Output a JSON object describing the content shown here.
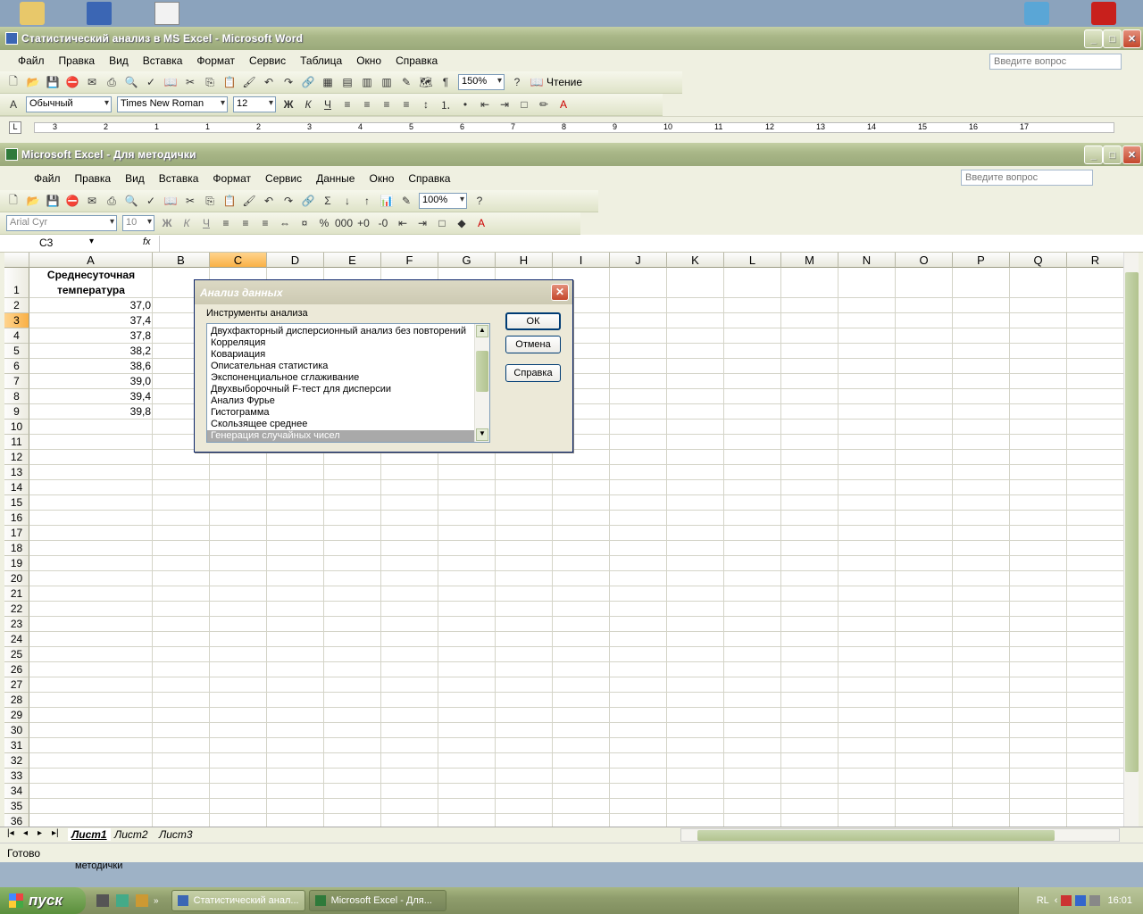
{
  "word": {
    "title": "Статистический анализ в MS Excel - Microsoft Word",
    "menu": [
      "Файл",
      "Правка",
      "Вид",
      "Вставка",
      "Формат",
      "Сервис",
      "Таблица",
      "Окно",
      "Справка"
    ],
    "question_placeholder": "Введите вопрос",
    "zoom": "150%",
    "reading_button": "Чтение",
    "style": "Обычный",
    "font": "Times New Roman",
    "font_size": "12",
    "ruler_numbers": [
      "3",
      "2",
      "1",
      "1",
      "2",
      "3",
      "4",
      "5",
      "6",
      "7",
      "8",
      "9",
      "10",
      "11",
      "12",
      "13",
      "14",
      "15",
      "16",
      "17"
    ]
  },
  "excel": {
    "title": "Microsoft Excel - Для методички",
    "menu": [
      "Файл",
      "Правка",
      "Вид",
      "Вставка",
      "Формат",
      "Сервис",
      "Данные",
      "Окно",
      "Справка"
    ],
    "question_placeholder": "Введите вопрос",
    "zoom": "100%",
    "font": "Arial Cyr",
    "font_size": "10",
    "name_box": "C3",
    "fx": "fx",
    "columns": [
      "A",
      "B",
      "C",
      "D",
      "E",
      "F",
      "G",
      "H",
      "I",
      "J",
      "K",
      "L",
      "M",
      "N",
      "O",
      "P",
      "Q",
      "R"
    ],
    "selected_column": "C",
    "selected_row": "3",
    "rows": [
      "1",
      "2",
      "3",
      "4",
      "5",
      "6",
      "7",
      "8",
      "9",
      "10",
      "11",
      "12",
      "13",
      "14",
      "15",
      "16",
      "17",
      "18",
      "19",
      "20",
      "21",
      "22",
      "23",
      "24",
      "25",
      "26",
      "27",
      "28",
      "29",
      "30",
      "31",
      "32",
      "33",
      "34",
      "35",
      "36"
    ],
    "header_line1": "Среднесуточная",
    "header_line2": "температура",
    "values": [
      "37,0",
      "37,4",
      "37,8",
      "38,2",
      "38,6",
      "39,0",
      "39,4",
      "39,8"
    ],
    "sheets": [
      "Лист1",
      "Лист2",
      "Лист3"
    ],
    "status": "Готово"
  },
  "dialog": {
    "title": "Анализ данных",
    "label": "Инструменты анализа",
    "items": [
      "Двухфакторный дисперсионный анализ без повторений",
      "Корреляция",
      "Ковариация",
      "Описательная статистика",
      "Экспоненциальное сглаживание",
      "Двухвыборочный F-тест для дисперсии",
      "Анализ Фурье",
      "Гистограмма",
      "Скользящее среднее",
      "Генерация случайных чисел"
    ],
    "selected_index": 9,
    "ok": "ОК",
    "cancel": "Отмена",
    "help": "Справка"
  },
  "desktop_label": "методички",
  "taskbar": {
    "start": "пуск",
    "tasks": [
      "Статистический анал...",
      "Microsoft Excel - Для..."
    ],
    "lang": "RL",
    "time": "16:01"
  }
}
